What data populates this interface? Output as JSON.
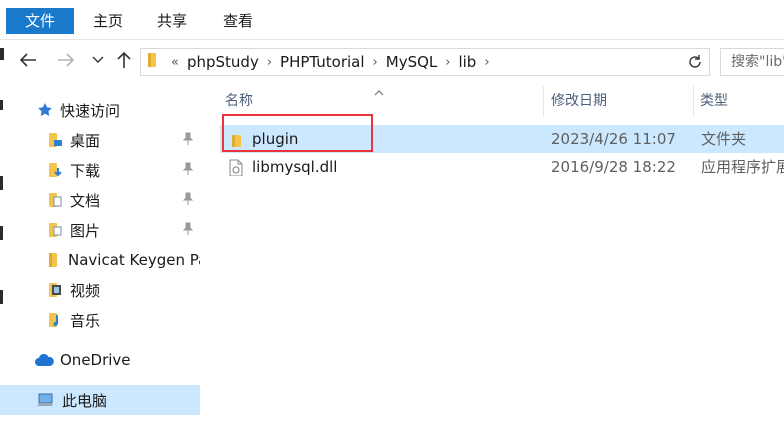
{
  "ribbon": {
    "file_tab": "文件",
    "tabs": [
      "主页",
      "共享",
      "查看"
    ]
  },
  "address_bar": {
    "overflow": "«",
    "crumbs": [
      "phpStudy",
      "PHPTutorial",
      "MySQL",
      "lib"
    ]
  },
  "search": {
    "placeholder": "搜索\"lib\""
  },
  "nav_pane": {
    "quick_access": "快速访问",
    "items": [
      "桌面",
      "下载",
      "文档",
      "图片",
      "Navicat Keygen Pa",
      "视频",
      "音乐"
    ],
    "onedrive": "OneDrive",
    "this_pc": "此电脑"
  },
  "file_list": {
    "columns": [
      "名称",
      "修改日期",
      "类型"
    ],
    "rows": [
      {
        "name": "plugin",
        "modified": "2023/4/26 11:07",
        "type": "文件夹"
      },
      {
        "name": "libmysql.dll",
        "modified": "2016/9/28 18:22",
        "type": "应用程序扩展"
      }
    ]
  },
  "colors": {
    "accent": "#1979ca",
    "selection": "#cce8ff",
    "highlight_box": "#e8343b",
    "folder": "#f3c34e"
  }
}
